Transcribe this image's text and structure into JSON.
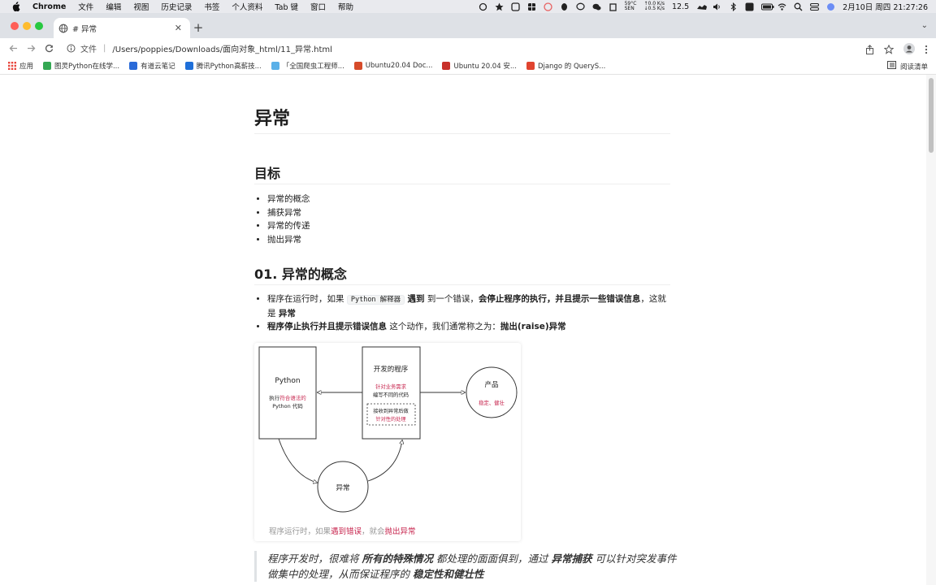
{
  "menubar": {
    "app_name": "Chrome",
    "items": [
      "文件",
      "编辑",
      "视图",
      "历史记录",
      "书签",
      "个人资料",
      "Tab 键",
      "窗口",
      "帮助"
    ],
    "weather_temp": "59°C",
    "weather_sub": "SEN",
    "net_up": "↑0.0 K/s",
    "net_down": "↓0.5 K/s",
    "cpu": "12.5",
    "datetime": "2月10日 周四  21:27:26"
  },
  "tab": {
    "title": "# 异常"
  },
  "address": {
    "scheme_label": "文件",
    "url": "/Users/poppies/Downloads/面向对象_html/11_异常.html"
  },
  "bookmarks": {
    "items": [
      {
        "label": "应用",
        "color": "#e8453c"
      },
      {
        "label": "图灵Python在线学...",
        "color": "#34a853"
      },
      {
        "label": "有道云笔记",
        "color": "#2a6ad8"
      },
      {
        "label": "腾讯Python高薪技...",
        "color": "#1e6fd9"
      },
      {
        "label": "「全国爬虫工程师...",
        "color": "#5ab0e8"
      },
      {
        "label": "Ubuntu20.04 Doc...",
        "color": "#d64b2a"
      },
      {
        "label": "Ubuntu 20.04 安...",
        "color": "#c8302a"
      },
      {
        "label": "Django 的 QueryS...",
        "color": "#e0442f"
      }
    ],
    "reading_list": "阅读清单"
  },
  "doc": {
    "title": "异常",
    "goals_heading": "目标",
    "goals": [
      "异常的概念",
      "捕获异常",
      "异常的传递",
      "抛出异常"
    ],
    "concept_heading": "01. 异常的概念",
    "b1_prefix": "程序在运行时，如果 ",
    "b1_code": "Python 解释器",
    "b1_bold1": "遇到",
    "b1_mid": " 到一个错误，",
    "b1_bold2": "会停止程序的执行，并且提示一些错误信息",
    "b1_tail": "，这就是 ",
    "b1_bold3": "异常",
    "b2_bold1": "程序停止执行并且提示错误信息",
    "b2_mid": " 这个动作，我们通常称之为：",
    "b2_bold2": "抛出(raise)异常",
    "quote_1": "程序开发时，很难将 ",
    "quote_b1": "所有的特殊情况",
    "quote_2": " 都处理的面面俱到，通过 ",
    "quote_b2": "异常捕获",
    "quote_3": " 可以针对突发事件做集中的处理，从而保证程序的 ",
    "quote_b3": "稳定性和健壮性"
  },
  "diagram": {
    "python_box": "Python",
    "python_sub1_a": "执行",
    "python_sub1_b": "符合语法的",
    "python_sub2": "Python 代码",
    "dev_box": "开发的程序",
    "dev_sub1": "针对业务需求",
    "dev_sub2": "编写不同的代码",
    "dev_dash1": "接收到异常后做",
    "dev_dash2": "针对性的处理",
    "product": "产品",
    "product_sub": "稳定、健壮",
    "exception": "异常",
    "caption_1": "程序运行时，如果",
    "caption_red1": "遇到错误",
    "caption_2": "，就会",
    "caption_red2": "抛出异常"
  }
}
